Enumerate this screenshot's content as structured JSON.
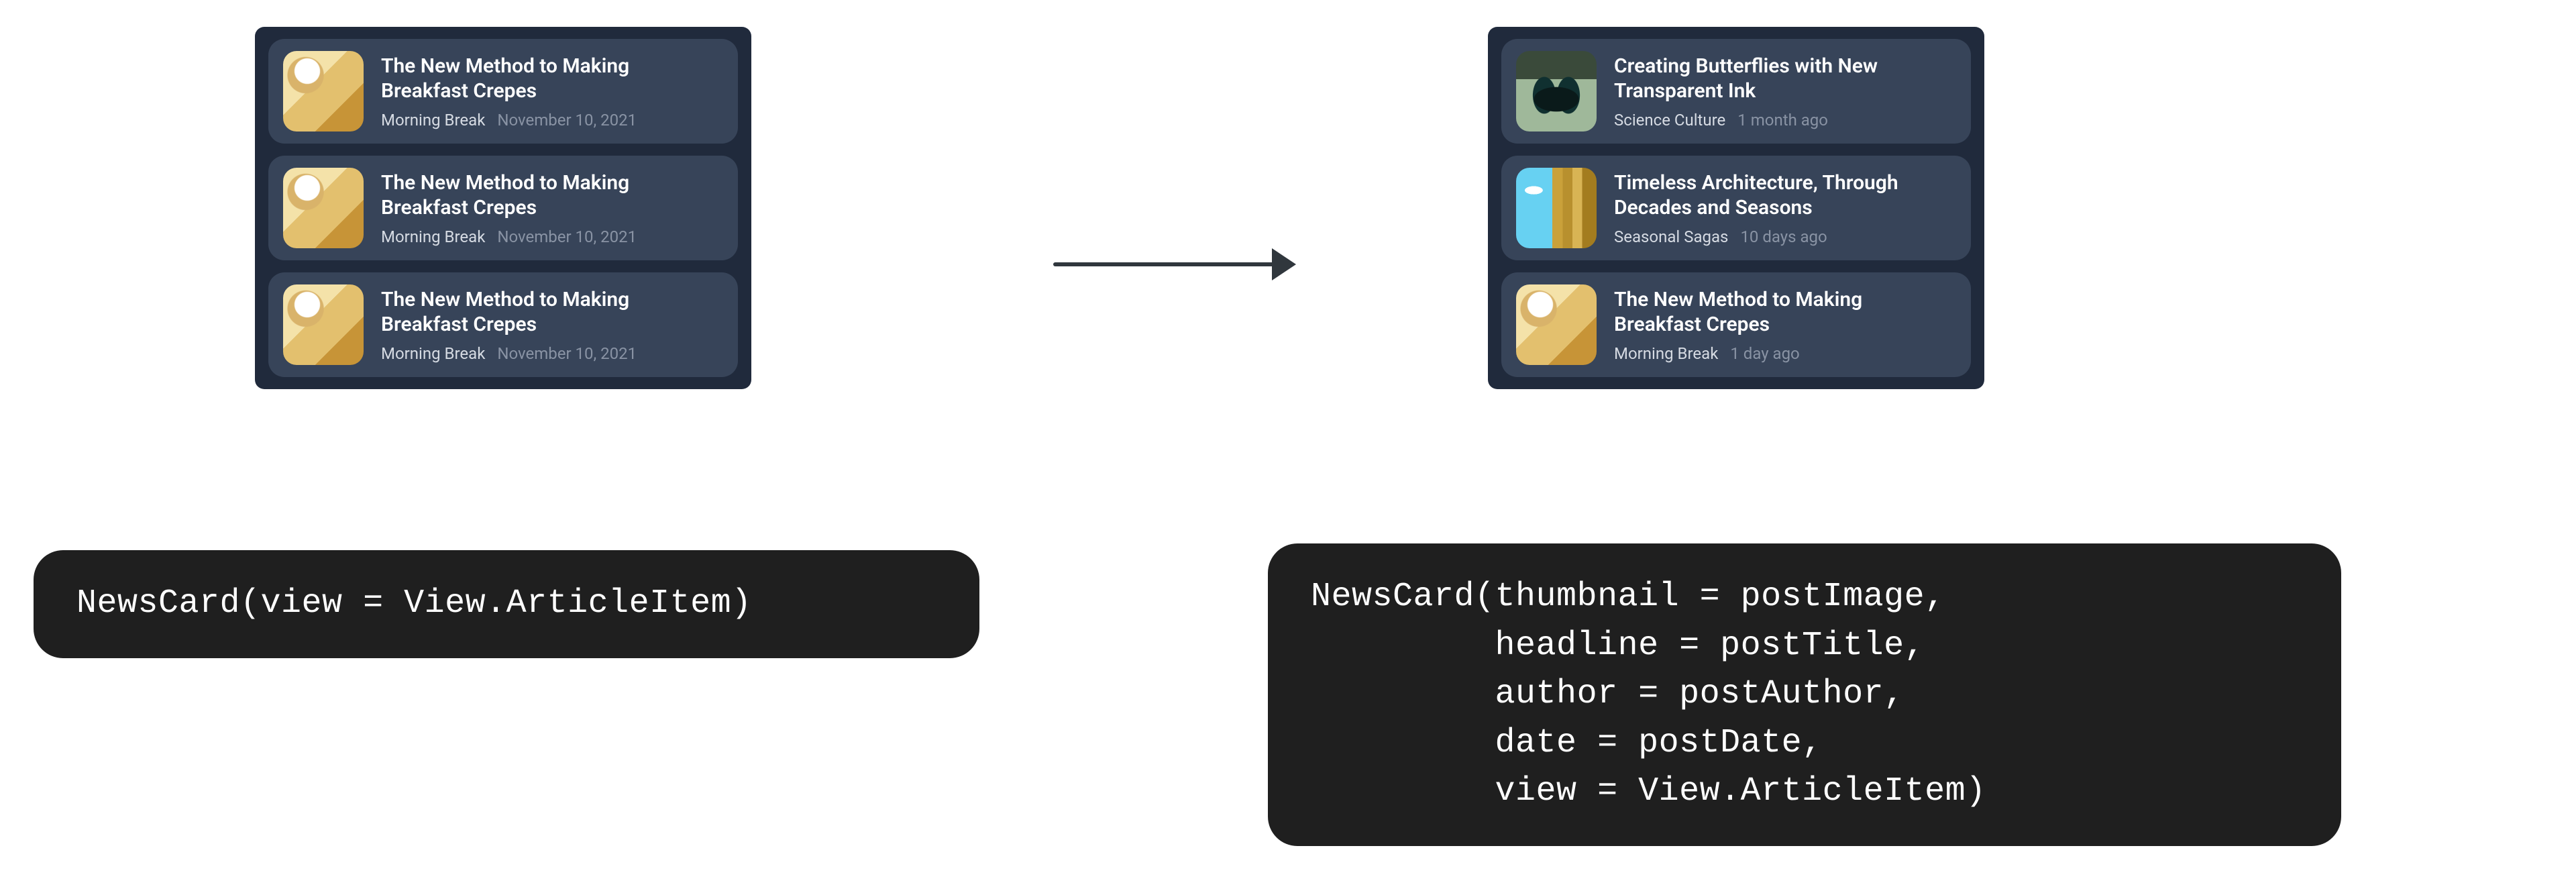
{
  "left_panel": {
    "items": [
      {
        "thumb_kind": "crepes",
        "headline": "The New Method to Making Breakfast Crepes",
        "author": "Morning Break",
        "date": "November 10, 2021"
      },
      {
        "thumb_kind": "crepes",
        "headline": "The New Method to Making Breakfast Crepes",
        "author": "Morning Break",
        "date": "November 10, 2021"
      },
      {
        "thumb_kind": "crepes",
        "headline": "The New Method to Making Breakfast Crepes",
        "author": "Morning Break",
        "date": "November 10, 2021"
      }
    ]
  },
  "right_panel": {
    "items": [
      {
        "thumb_kind": "butterfly",
        "headline": "Creating Butterflies with New Transparent Ink",
        "author": "Science Culture",
        "date": "1 month ago"
      },
      {
        "thumb_kind": "arch",
        "headline": "Timeless Architecture, Through Decades and Seasons",
        "author": "Seasonal Sagas",
        "date": "10 days ago"
      },
      {
        "thumb_kind": "crepes",
        "headline": "The New Method to Making Breakfast Crepes",
        "author": "Morning Break",
        "date": "1 day ago"
      }
    ]
  },
  "code_left": "NewsCard(view = View.ArticleItem)",
  "code_right": "NewsCard(thumbnail = postImage,\n         headline = postTitle,\n         author = postAuthor,\n         date = postDate,\n         view = View.ArticleItem)"
}
